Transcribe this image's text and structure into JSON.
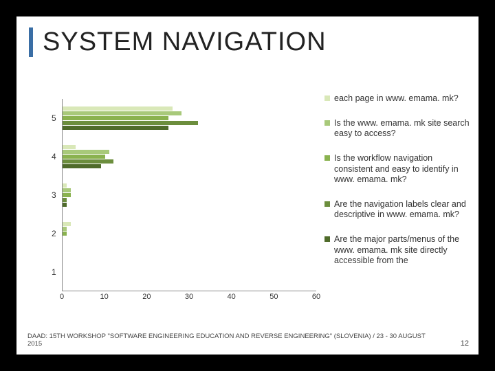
{
  "title": "SYSTEM NAVIGATION",
  "footer": "DAAD: 15TH WORKSHOP \"SOFTWARE ENGINEERING EDUCATION AND REVERSE ENGINEERING\" (SLOVENIA) / 23 - 30 AUGUST 2015",
  "page_number": "12",
  "legend": {
    "s0": "each page in www. emama. mk?",
    "s1": "Is the www. emama. mk site search easy to access?",
    "s2": "Is the workflow navigation consistent and easy to identify in www. emama. mk?",
    "s3": "Are the navigation labels clear and descriptive in www. emama. mk?",
    "s4": "Are the major parts/menus of the www. emama. mk site directly accessible from the"
  },
  "chart_data": {
    "type": "bar",
    "orientation": "horizontal",
    "xlabel": "",
    "ylabel": "",
    "xlim": [
      0,
      60
    ],
    "xticks": [
      0,
      10,
      20,
      30,
      40,
      50,
      60
    ],
    "categories": [
      "5",
      "4",
      "3",
      "2",
      "1"
    ],
    "series": [
      {
        "name": "each page in www. emama. mk?",
        "color": "#d9e8b8",
        "values": [
          26,
          3,
          1,
          2,
          0
        ]
      },
      {
        "name": "Is the www. emama. mk site search easy to access?",
        "color": "#a8c97a",
        "values": [
          28,
          11,
          2,
          1,
          0
        ]
      },
      {
        "name": "Is the workflow navigation consistent and easy to identify in www. emama. mk?",
        "color": "#8ab24f",
        "values": [
          25,
          10,
          2,
          1,
          0
        ]
      },
      {
        "name": "Are the navigation labels clear and descriptive in www. emama. mk?",
        "color": "#6c8e3d",
        "values": [
          32,
          12,
          1,
          0,
          0
        ]
      },
      {
        "name": "Are the major parts/menus of the www. emama. mk site directly accessible from the",
        "color": "#4f6b2a",
        "values": [
          25,
          9,
          1,
          0,
          0
        ]
      }
    ]
  }
}
